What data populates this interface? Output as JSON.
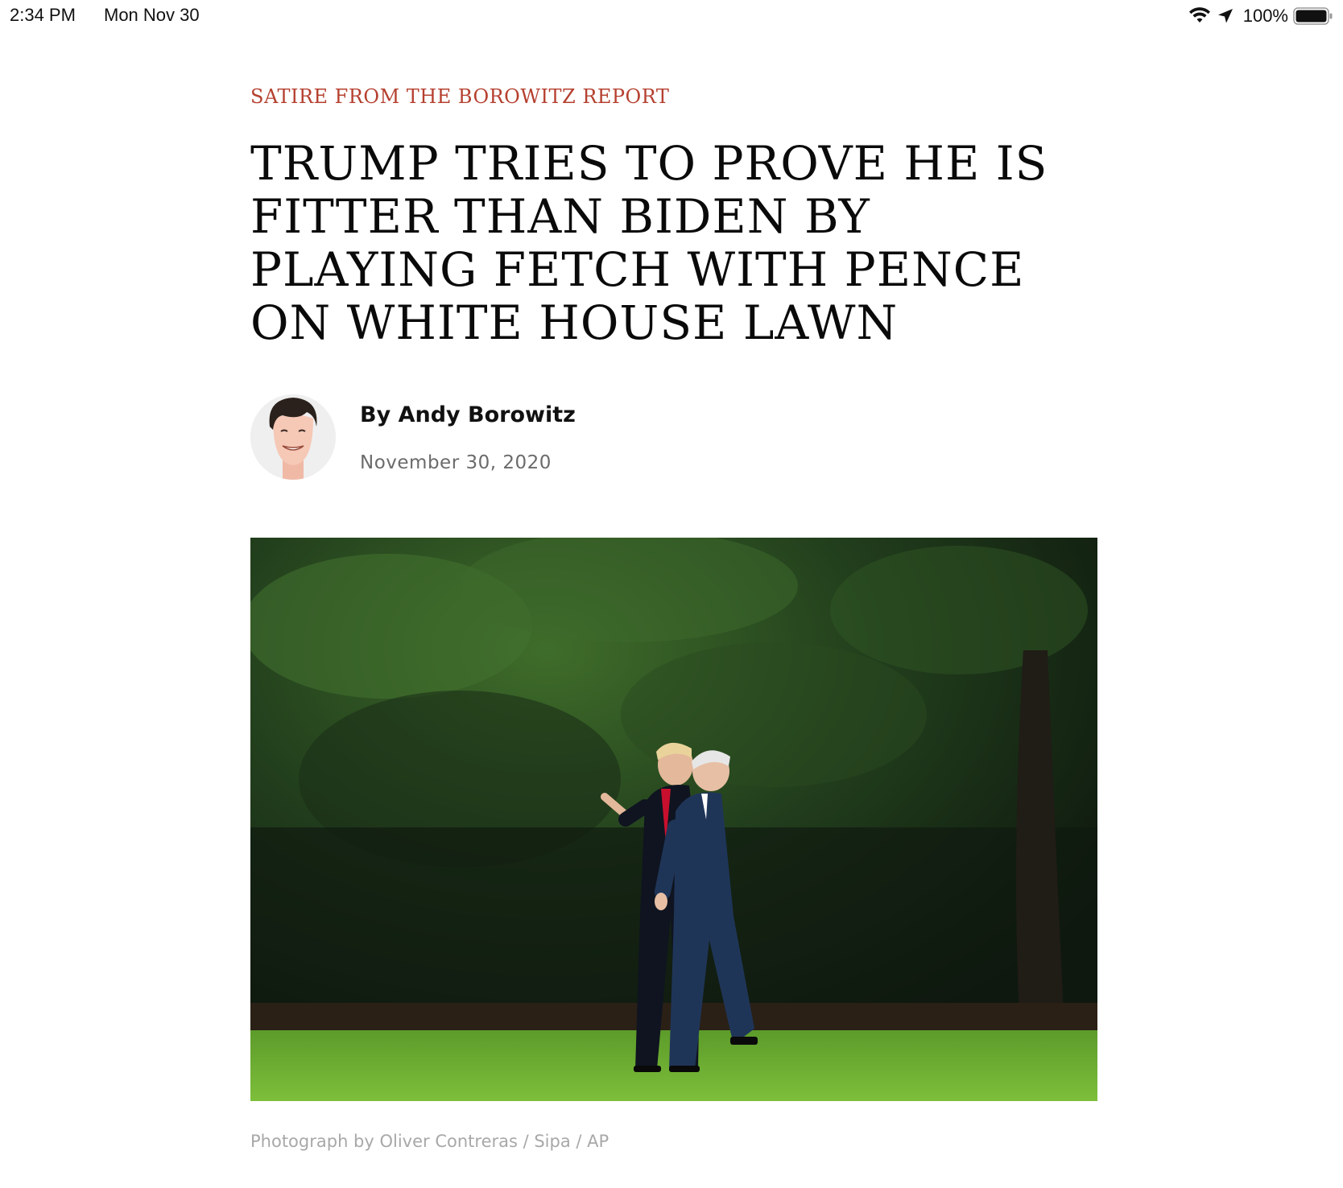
{
  "status_bar": {
    "time": "2:34 PM",
    "date": "Mon Nov 30",
    "battery": "100%",
    "icons": [
      "wifi-icon",
      "location-icon",
      "battery-icon"
    ]
  },
  "article": {
    "rubric": "SATIRE FROM THE BOROWITZ REPORT",
    "headline": "TRUMP TRIES TO PROVE HE IS FITTER THAN BIDEN BY PLAYING FETCH WITH PENCE ON WHITE HOUSE LAWN",
    "author": "By Andy Borowitz",
    "date": "November 30, 2020",
    "photo_caption": "Photograph by Oliver Contreras / Sipa / AP"
  },
  "colors": {
    "rubric": "#b5402f",
    "headline": "#0a0a0a",
    "date": "#6b6b6b",
    "caption": "#a8a8a8"
  }
}
